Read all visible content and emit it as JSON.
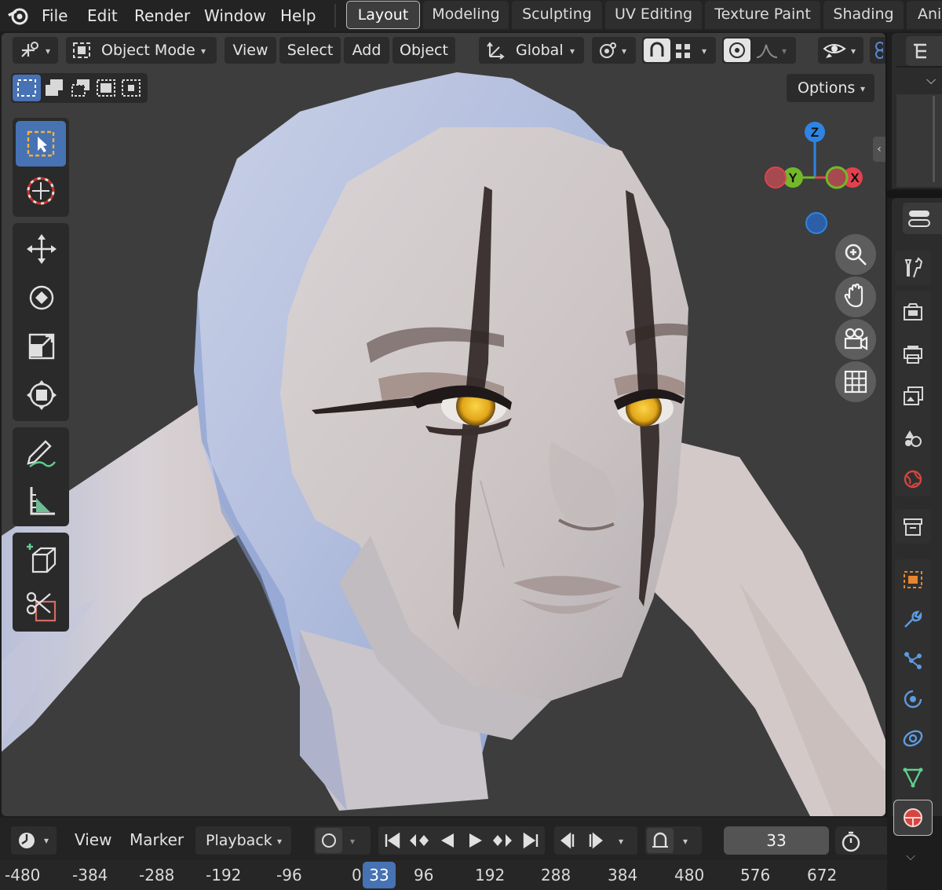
{
  "menubar": {
    "items": [
      "File",
      "Edit",
      "Render",
      "Window",
      "Help"
    ],
    "workspaces": [
      "Layout",
      "Modeling",
      "Sculpting",
      "UV Editing",
      "Texture Paint",
      "Shading",
      "Ani"
    ],
    "active_workspace": "Layout"
  },
  "viewport_header": {
    "mode": "Object Mode",
    "menus": [
      "View",
      "Select",
      "Add",
      "Object"
    ],
    "orientation": "Global",
    "options_label": "Options"
  },
  "gizmo": {
    "axis_z": "Z",
    "axis_y": "Y",
    "axis_x": "X"
  },
  "timeline": {
    "menus": [
      "View",
      "Marker",
      "Playback"
    ],
    "current_frame": "33",
    "ruler": [
      "-480",
      "-384",
      "-288",
      "-192",
      "-96",
      "0",
      "96",
      "192",
      "288",
      "384",
      "480",
      "576",
      "672"
    ]
  },
  "colors": {
    "active_tool": "#4772b3",
    "axis_x": "#e0424f",
    "axis_y": "#73b82a",
    "axis_z": "#2f84e3",
    "viewport_bg": "#3d3d3d"
  },
  "icons": {
    "tools": [
      "select-box-icon",
      "cursor-icon",
      "move-icon",
      "rotate-icon",
      "scale-icon",
      "transform-icon",
      "annotate-icon",
      "measure-icon",
      "add-cube-icon",
      "knife-icon"
    ],
    "properties": [
      "tool-icon",
      "render-icon",
      "output-icon",
      "view-layer-icon",
      "scene-icon",
      "world-icon",
      "collection-icon",
      "object-icon",
      "modifier-icon",
      "particles-icon",
      "physics-icon",
      "constraints-icon",
      "data-icon",
      "material-icon"
    ]
  }
}
